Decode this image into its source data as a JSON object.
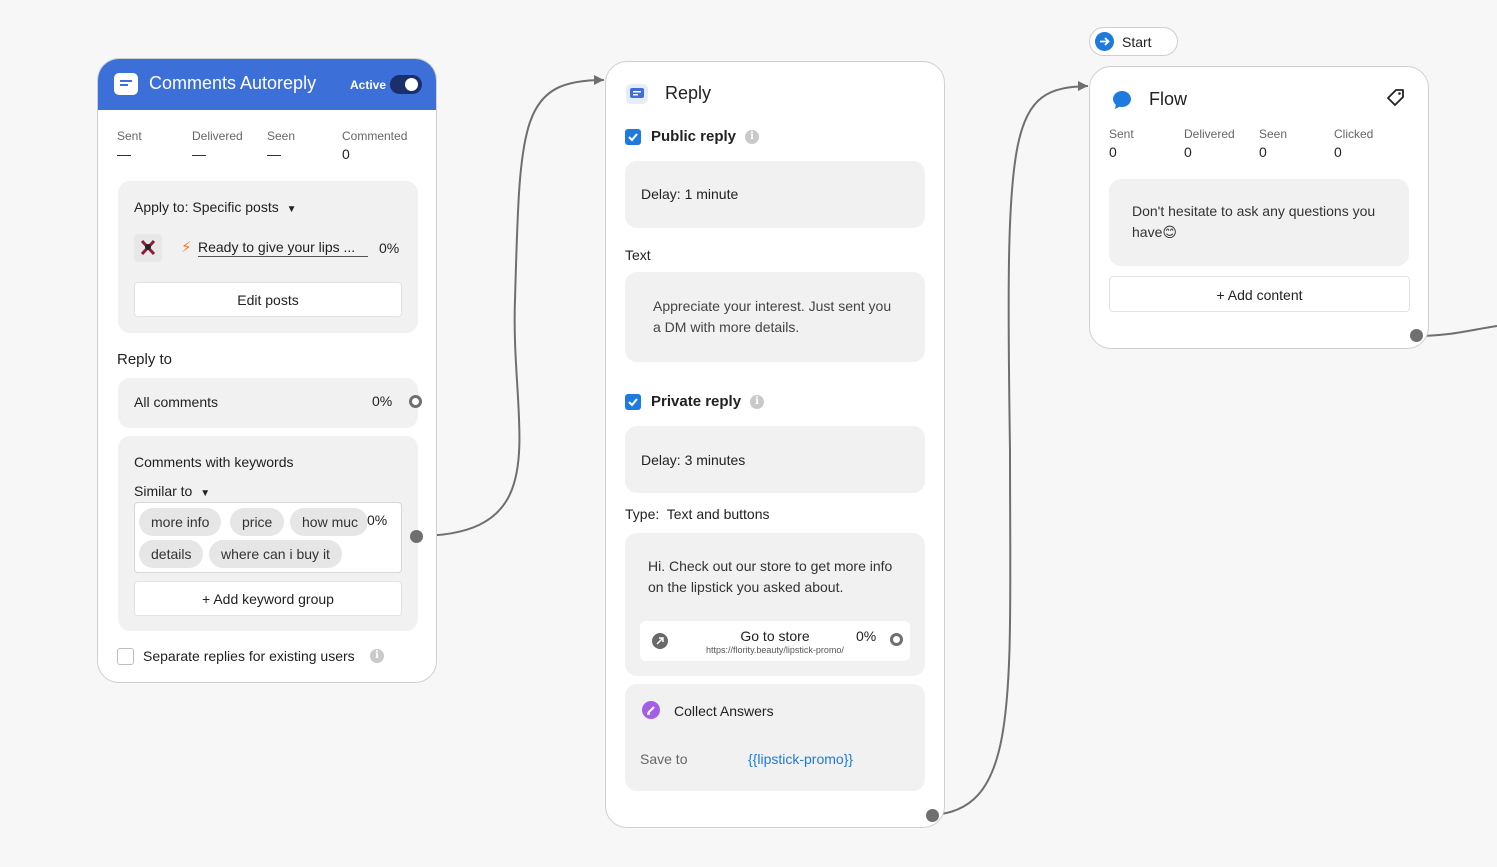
{
  "autoreply": {
    "title": "Comments Autoreply",
    "status_label": "Active",
    "stats": [
      {
        "label": "Sent",
        "value": "—"
      },
      {
        "label": "Delivered",
        "value": "—"
      },
      {
        "label": "Seen",
        "value": "—"
      },
      {
        "label": "Commented",
        "value": "0"
      }
    ],
    "apply_to_label": "Apply to: Specific posts",
    "post_title": "Ready to give your lips ...",
    "post_percent": "0%",
    "edit_posts_label": "Edit posts",
    "reply_to_heading": "Reply to",
    "all_comments_label": "All comments",
    "all_comments_percent": "0%",
    "keywords_heading": "Comments with keywords",
    "match_mode": "Similar to",
    "keywords": [
      "more info",
      "price",
      "how muc",
      "details",
      "where can i buy it"
    ],
    "keywords_percent": "0%",
    "add_keyword_group_label": "+  Add keyword group",
    "separate_replies_label": "Separate replies for existing users",
    "accent_color": "#3c6fd8"
  },
  "reply": {
    "title": "Reply",
    "public_reply_label": "Public reply",
    "public_delay": "Delay: 1 minute",
    "text_heading": "Text",
    "public_text": "Appreciate your interest. Just sent you a DM with more details.",
    "private_reply_label": "Private reply",
    "private_delay": "Delay: 3 minutes",
    "type_label": "Type:  Text and buttons",
    "private_text": "Hi. Check out our store to get more info on the lipstick you asked about.",
    "button_label": "Go to store",
    "button_url": "https://flority.beauty/lipstick-promo/",
    "button_percent": "0%",
    "collect_answers_label": "Collect Answers",
    "save_to_label": "Save to",
    "save_to_variable": "{{lipstick-promo}}"
  },
  "flow": {
    "start_label": "Start",
    "title": "Flow",
    "stats": [
      {
        "label": "Sent",
        "value": "0"
      },
      {
        "label": "Delivered",
        "value": "0"
      },
      {
        "label": "Seen",
        "value": "0"
      },
      {
        "label": "Clicked",
        "value": "0"
      }
    ],
    "message_text": "Don't hesitate to ask any questions you have😊",
    "add_content_label": "+ Add content"
  }
}
